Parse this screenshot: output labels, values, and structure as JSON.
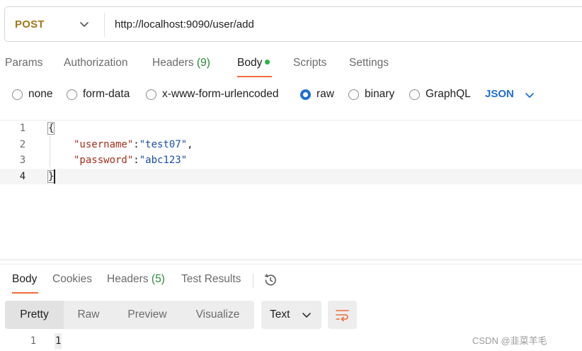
{
  "request": {
    "method": "POST",
    "url": "http://localhost:9090/user/add"
  },
  "request_tabs": {
    "params": "Params",
    "authorization": "Authorization",
    "headers": "Headers",
    "headers_count": "(9)",
    "body": "Body",
    "scripts": "Scripts",
    "settings": "Settings"
  },
  "body_types": {
    "none": "none",
    "form_data": "form-data",
    "urlencoded": "x-www-form-urlencoded",
    "raw": "raw",
    "binary": "binary",
    "graphql": "GraphQL",
    "selected": "raw",
    "format": "JSON"
  },
  "editor": {
    "line_numbers": [
      "1",
      "2",
      "3",
      "4"
    ],
    "open_brace": "{",
    "close_brace": "}",
    "k1": "\"username\"",
    "v1": "\"test07\"",
    "k2": "\"password\"",
    "v2": "\"abc123\"",
    "colon": ":",
    "comma": ","
  },
  "response_tabs": {
    "body": "Body",
    "cookies": "Cookies",
    "headers": "Headers",
    "headers_count": "(5)",
    "test_results": "Test Results"
  },
  "response_view": {
    "pretty": "Pretty",
    "raw": "Raw",
    "preview": "Preview",
    "visualize": "Visualize",
    "text_format": "Text"
  },
  "response_body": {
    "line_number": "1",
    "value": "1"
  },
  "watermark": "CSDN @韭菜羊毛",
  "colors": {
    "accent": "#f26b3a",
    "method": "#a0781a",
    "link_blue": "#1f6fd6",
    "count_green": "#2c8a3a",
    "json_key": "#a5301c",
    "json_string": "#1a4fa0"
  }
}
